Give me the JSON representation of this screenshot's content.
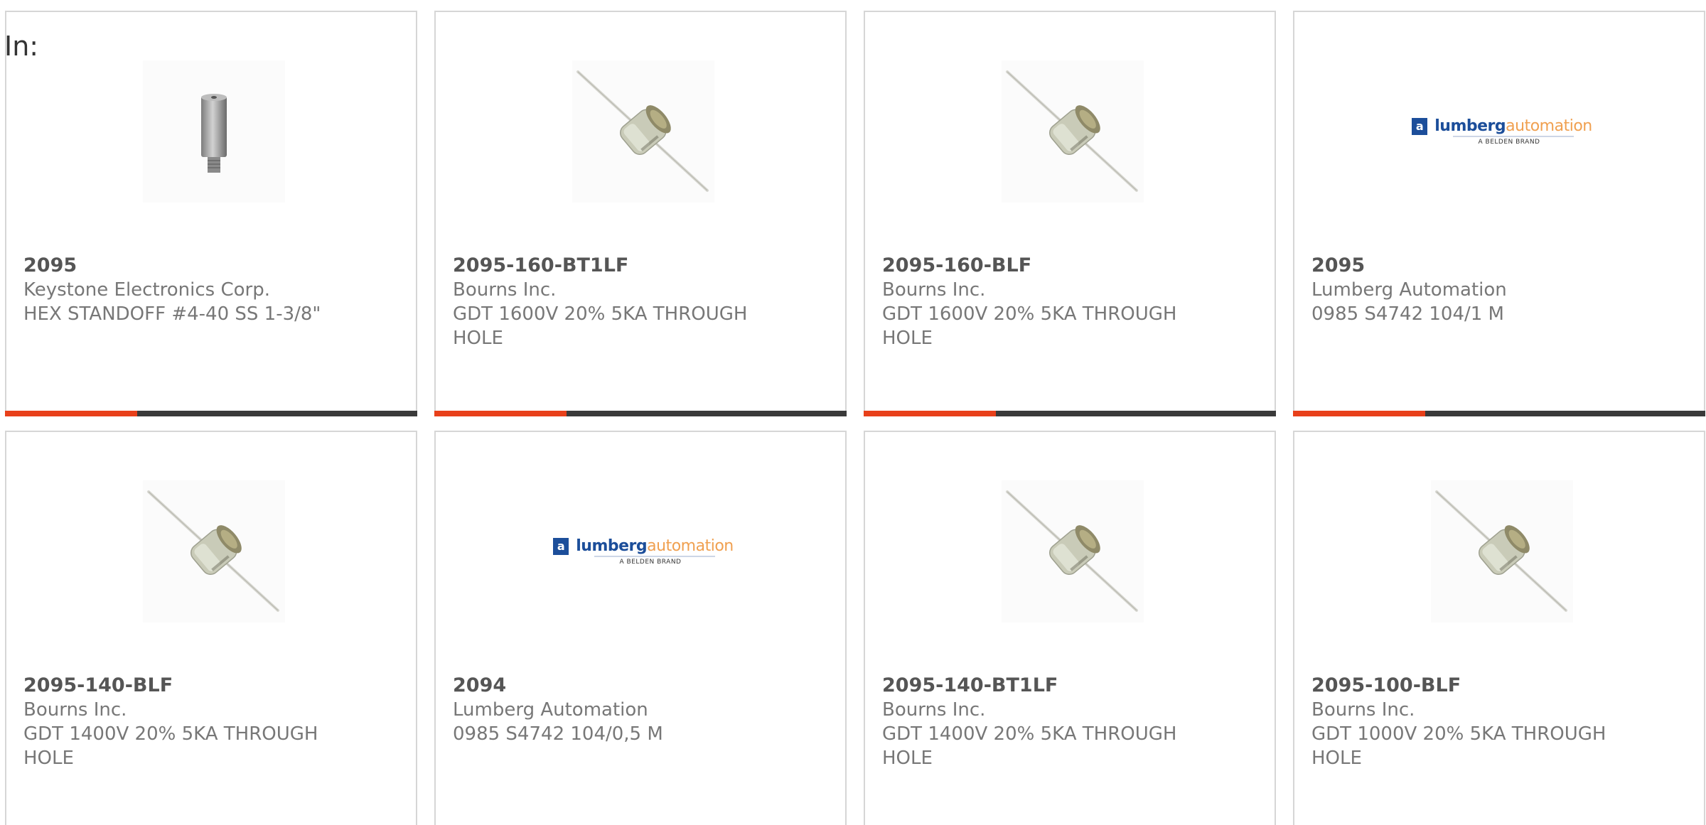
{
  "header": {
    "in_label": "In:"
  },
  "colors": {
    "accent": "#e8401a",
    "bar": "#3a3a3a",
    "border": "#d6d6d6"
  },
  "products": [
    {
      "part": "2095",
      "manufacturer": "Keystone Electronics Corp.",
      "description": "HEX STANDOFF #4-40 SS 1-3/8\"",
      "image": "hex-standoff-icon",
      "progress": 0.32
    },
    {
      "part": "2095-160-BT1LF",
      "manufacturer": "Bourns Inc.",
      "description": "GDT 1600V 20% 5KA THROUGH HOLE",
      "image": "gas-discharge-tube-icon",
      "progress": 0.32
    },
    {
      "part": "2095-160-BLF",
      "manufacturer": "Bourns Inc.",
      "description": "GDT 1600V 20% 5KA THROUGH HOLE",
      "image": "gas-discharge-tube-icon",
      "progress": 0.32
    },
    {
      "part": "2095",
      "manufacturer": "Lumberg Automation",
      "description": "0985 S4742 104/1 M",
      "image": "lumberg-logo",
      "logo": {
        "mark": "a",
        "word_bold": "lumberg",
        "word_light": "automation",
        "sub": "A BELDEN BRAND"
      },
      "progress": 0.32
    },
    {
      "part": "2095-140-BLF",
      "manufacturer": "Bourns Inc.",
      "description": "GDT 1400V 20% 5KA THROUGH HOLE",
      "image": "gas-discharge-tube-icon",
      "progress": 0
    },
    {
      "part": "2094",
      "manufacturer": "Lumberg Automation",
      "description": "0985 S4742 104/0,5 M",
      "image": "lumberg-logo",
      "logo": {
        "mark": "a",
        "word_bold": "lumberg",
        "word_light": "automation",
        "sub": "A BELDEN BRAND"
      },
      "progress": 0
    },
    {
      "part": "2095-140-BT1LF",
      "manufacturer": "Bourns Inc.",
      "description": "GDT 1400V 20% 5KA THROUGH HOLE",
      "image": "gas-discharge-tube-icon",
      "progress": 0
    },
    {
      "part": "2095-100-BLF",
      "manufacturer": "Bourns Inc.",
      "description": "GDT 1000V 20% 5KA THROUGH HOLE",
      "image": "gas-discharge-tube-icon",
      "progress": 0
    }
  ]
}
